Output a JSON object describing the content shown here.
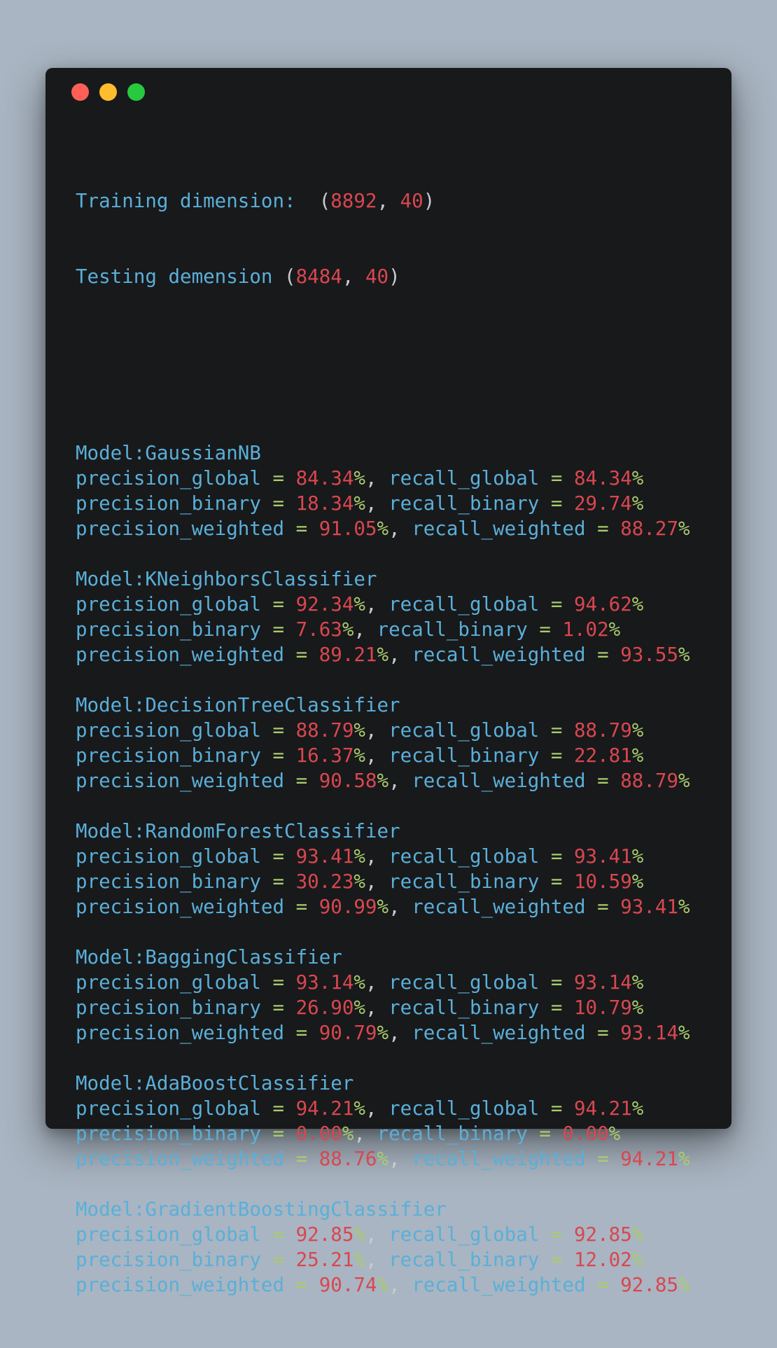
{
  "window": {
    "controls": [
      "close",
      "minimize",
      "maximize"
    ]
  },
  "dims": {
    "train_label": "Training dimension:",
    "train_rows": "8892",
    "train_cols": "40",
    "test_label": "Testing demension",
    "test_rows": "8484",
    "test_cols": "40"
  },
  "labels": {
    "model_prefix": "Model:",
    "precision_global": "precision_global",
    "recall_global": "recall_global",
    "precision_binary": "precision_binary",
    "recall_binary": "recall_binary",
    "precision_weighted": "precision_weighted",
    "recall_weighted": "recall_weighted",
    "equals": "=",
    "percent": "%"
  },
  "models": [
    {
      "name": "GaussianNB",
      "precision_global": "84.34",
      "recall_global": "84.34",
      "precision_binary": "18.34",
      "recall_binary": "29.74",
      "precision_weighted": "91.05",
      "recall_weighted": "88.27"
    },
    {
      "name": "KNeighborsClassifier",
      "precision_global": "92.34",
      "recall_global": "94.62",
      "precision_binary": "7.63",
      "recall_binary": "1.02",
      "precision_weighted": "89.21",
      "recall_weighted": "93.55"
    },
    {
      "name": "DecisionTreeClassifier",
      "precision_global": "88.79",
      "recall_global": "88.79",
      "precision_binary": "16.37",
      "recall_binary": "22.81",
      "precision_weighted": "90.58",
      "recall_weighted": "88.79"
    },
    {
      "name": "RandomForestClassifier",
      "precision_global": "93.41",
      "recall_global": "93.41",
      "precision_binary": "30.23",
      "recall_binary": "10.59",
      "precision_weighted": "90.99",
      "recall_weighted": "93.41"
    },
    {
      "name": "BaggingClassifier",
      "precision_global": "93.14",
      "recall_global": "93.14",
      "precision_binary": "26.90",
      "recall_binary": "10.79",
      "precision_weighted": "90.79",
      "recall_weighted": "93.14"
    },
    {
      "name": "AdaBoostClassifier",
      "precision_global": "94.21",
      "recall_global": "94.21",
      "precision_binary": "0.00",
      "recall_binary": "0.00",
      "precision_weighted": "88.76",
      "recall_weighted": "94.21"
    },
    {
      "name": "GradientBoostingClassifier",
      "precision_global": "92.85",
      "recall_global": "92.85",
      "precision_binary": "25.21",
      "recall_binary": "12.02",
      "precision_weighted": "90.74",
      "recall_weighted": "92.85"
    }
  ]
}
